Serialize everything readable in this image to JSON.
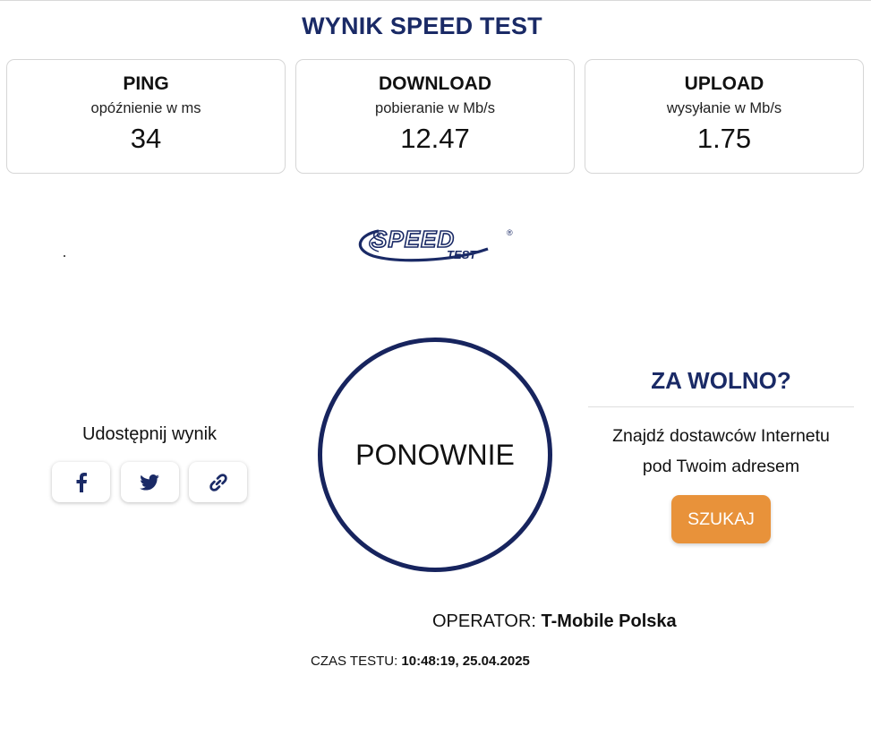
{
  "header": {
    "title": "WYNIK SPEED TEST"
  },
  "results": {
    "ping": {
      "title": "PING",
      "subtitle": "opóźnienie w ms",
      "value": "34"
    },
    "download": {
      "title": "DOWNLOAD",
      "subtitle": "pobieranie w Mb/s",
      "value": "12.47"
    },
    "upload": {
      "title": "UPLOAD",
      "subtitle": "wysyłanie w Mb/s",
      "value": "1.75"
    }
  },
  "logo": {
    "main": "SPEED",
    "sub": "TEST",
    "mark": "®"
  },
  "share": {
    "label": "Udostępnij wynik",
    "buttons": [
      {
        "icon": "facebook-icon"
      },
      {
        "icon": "twitter-icon"
      },
      {
        "icon": "link-icon"
      }
    ]
  },
  "retest": {
    "label": "PONOWNIE"
  },
  "too_slow": {
    "title": "ZA WOLNO?",
    "line1": "Znajdź dostawców Internetu",
    "line2": "pod Twoim adresem",
    "button": "SZUKAJ"
  },
  "operator": {
    "label": "OPERATOR:",
    "value": "T-Mobile Polska"
  },
  "test_time": {
    "label": "CZAS TESTU:",
    "value": "10:48:19, 25.04.2025"
  },
  "colors": {
    "navy": "#1a2a66",
    "orange": "#e8923a",
    "ring": "#17245e"
  }
}
